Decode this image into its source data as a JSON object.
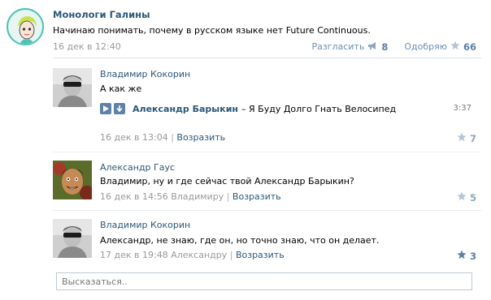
{
  "post": {
    "author": "Монологи Галины",
    "text": "Начинаю понимать, почему в русском языке нет Future Continuous.",
    "date": "16 дек в 12:40",
    "share_label": "Разгласить",
    "share_count": "8",
    "like_label": "Одобряю",
    "like_count": "66"
  },
  "comments": [
    {
      "author": "Владимир Кокорин",
      "text": "А как же",
      "audio": {
        "artist": "Александр Барыкин",
        "title": "– Я Буду Долго Гнать Велосипед",
        "duration": "3:37"
      },
      "date": "16 дек в 13:04",
      "sep": "|",
      "reply_label": "Возразить",
      "likes": "7"
    },
    {
      "author": "Александр Гаус",
      "text": "Владимир, ну и где сейчас твой Александр Барыкин?",
      "date": "16 дек в 14:56",
      "to": "Владимиру",
      "sep": "|",
      "reply_label": "Возразить",
      "likes": "5"
    },
    {
      "author": "Владимир Кокорин",
      "text": "Александр, не знаю, где он, но точно знаю, что он делает.",
      "date": "17 дек в 19:48",
      "to": "Александру",
      "sep": "|",
      "reply_label": "Возразить",
      "likes": "3"
    }
  ],
  "reply_placeholder": "Высказаться..",
  "colors": {
    "link": "#2b587a",
    "accent": "#5f82a8",
    "meta": "#999999",
    "like_active": "#5b7fa6"
  }
}
